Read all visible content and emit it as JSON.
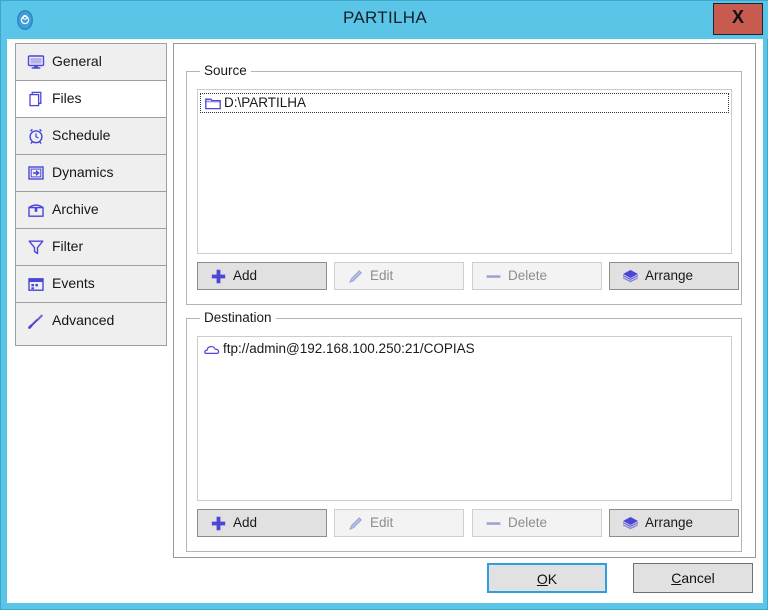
{
  "window": {
    "title": "PARTILHA",
    "app_icon": "disc-icon",
    "close_label": "X",
    "titlebar_color": "#5bc5e8",
    "close_button_color": "#c75b50",
    "accent_color": "#4a46d8"
  },
  "tabs": [
    {
      "label": "General",
      "icon": "monitor-icon",
      "selected": false
    },
    {
      "label": "Files",
      "icon": "files-icon",
      "selected": true
    },
    {
      "label": "Schedule",
      "icon": "alarm-clock-icon",
      "selected": false
    },
    {
      "label": "Dynamics",
      "icon": "arrow-in-box-icon",
      "selected": false
    },
    {
      "label": "Archive",
      "icon": "archive-box-icon",
      "selected": false
    },
    {
      "label": "Filter",
      "icon": "funnel-icon",
      "selected": false
    },
    {
      "label": "Events",
      "icon": "calendar-icon",
      "selected": false
    },
    {
      "label": "Advanced",
      "icon": "wrench-icon",
      "selected": false
    }
  ],
  "source": {
    "group_title": "Source",
    "items": [
      {
        "label": "D:\\PARTILHA",
        "icon": "folder-icon",
        "focused": true
      }
    ],
    "buttons": [
      {
        "label": "Add",
        "icon": "plus-icon",
        "enabled": true
      },
      {
        "label": "Edit",
        "icon": "pencil-icon",
        "enabled": false
      },
      {
        "label": "Delete",
        "icon": "minus-icon",
        "enabled": false
      },
      {
        "label": "Arrange",
        "icon": "layers-icon",
        "enabled": true
      }
    ]
  },
  "destination": {
    "group_title": "Destination",
    "items": [
      {
        "label": "ftp://admin@192.168.100.250:21/COPIAS",
        "icon": "cloud-icon",
        "focused": false
      }
    ],
    "buttons": [
      {
        "label": "Add",
        "icon": "plus-icon",
        "enabled": true
      },
      {
        "label": "Edit",
        "icon": "pencil-icon",
        "enabled": false
      },
      {
        "label": "Delete",
        "icon": "minus-icon",
        "enabled": false
      },
      {
        "label": "Arrange",
        "icon": "layers-icon",
        "enabled": true
      }
    ]
  },
  "footer": {
    "ok": {
      "accel": "O",
      "rest": "K"
    },
    "cancel": {
      "accel": "C",
      "rest": "ancel"
    }
  }
}
